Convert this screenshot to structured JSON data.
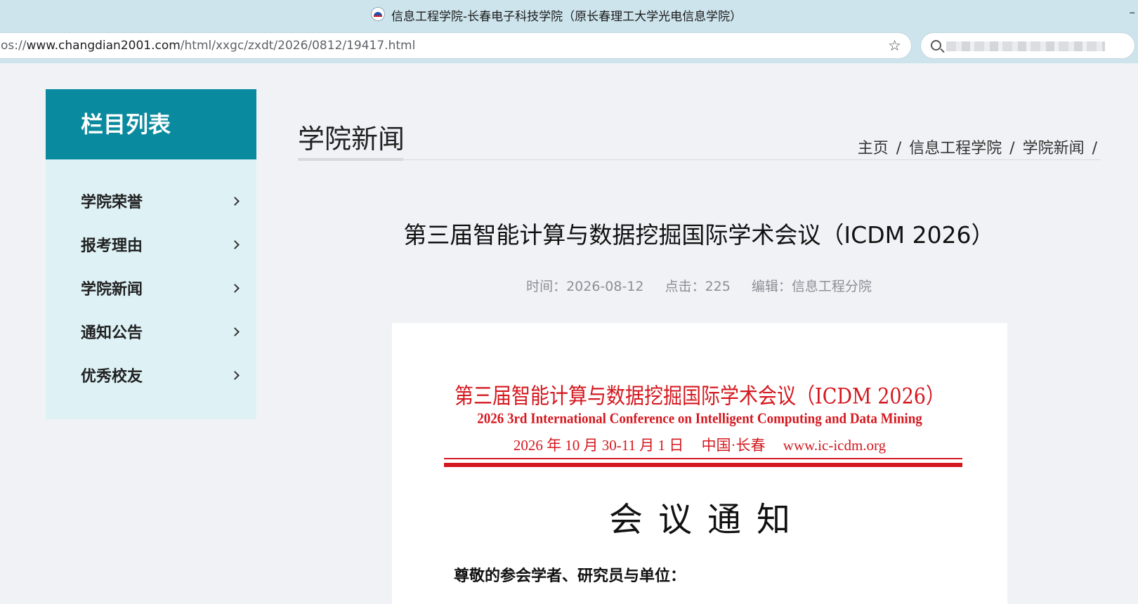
{
  "browser": {
    "tab_title": "信息工程学院-长春电子科技学院（原长春理工大学光电信息学院）",
    "url_prefix": "os://",
    "url_host": "www.changdian2001.com",
    "url_path": "/html/xxgc/zxdt/2026/0812/19417.html",
    "minimize": "–"
  },
  "icons": {
    "bookmark": "star-icon",
    "search": "search-icon",
    "chevron": "chevron-right-icon"
  },
  "colors": {
    "sidebar_header": "#0a8a9e",
    "sidebar_bg": "#def2f6",
    "notice_red": "#d4181f"
  },
  "sidebar": {
    "header": "栏目列表",
    "items": [
      {
        "label": "学院荣誉"
      },
      {
        "label": "报考理由"
      },
      {
        "label": "学院新闻"
      },
      {
        "label": "通知公告"
      },
      {
        "label": "优秀校友"
      }
    ]
  },
  "content": {
    "section_title": "学院新闻",
    "breadcrumb": [
      "主页",
      "信息工程学院",
      "学院新闻"
    ],
    "breadcrumb_sep": "/",
    "article_title": "第三届智能计算与数据挖掘国际学术会议（ICDM 2026）",
    "meta": {
      "time": "时间：2026-08-12",
      "clicks": "点击：225",
      "editor": "编辑：信息工程分院"
    }
  },
  "notice": {
    "cn_title": "第三届智能计算与数据挖掘国际学术会议（ICDM 2026）",
    "en_title": "2026 3rd International Conference on Intelligent Computing and Data Mining",
    "date": "2026 年 10 月 30-11 月 1 日",
    "place": "中国·长春",
    "site": "www.ic-icdm.org",
    "heading": "会议通知",
    "salutation": "尊敬的参会学者、研究员与单位："
  }
}
